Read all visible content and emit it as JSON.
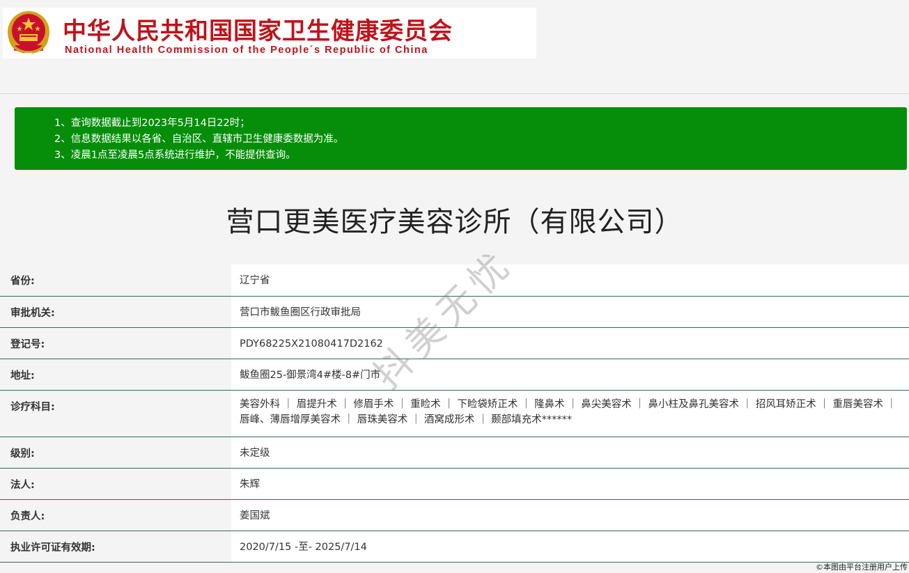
{
  "header": {
    "logo_cn": "中华人民共和国国家卫生健康委员会",
    "logo_en": "National Health Commission of the People´s Republic of China",
    "brand_red": "#c0121a"
  },
  "notice": {
    "bg_color": "#068e0a",
    "lines": [
      "1、查询数据截止到2023年5月14日22时；",
      "2、信息数据结果以各省、自治区、直辖市卫生健康委数据为准。",
      "3、凌晨1点至凌晨5点系统进行维护，不能提供查询。"
    ]
  },
  "org": {
    "title": "营口更美医疗美容诊所（有限公司）"
  },
  "fields": [
    {
      "label": "省份:",
      "value": "辽宁省"
    },
    {
      "label": "审批机关:",
      "value": "营口市鲅鱼圈区行政审批局"
    },
    {
      "label": "登记号:",
      "value": "PDY68225X21080417D2162"
    },
    {
      "label": "地址:",
      "value": "鲅鱼圈25-御景湾4#楼-8#门市"
    },
    {
      "label": "诊疗科目:",
      "value": "美容外科 ｜ 眉提升术 ｜ 修眉手术 ｜ 重睑术 ｜ 下睑袋矫正术 ｜ 隆鼻术 ｜ 鼻尖美容术 ｜ 鼻小柱及鼻孔美容术 ｜ 招风耳矫正术 ｜ 重唇美容术 ｜ 唇峰、薄唇增厚美容术 ｜ 唇珠美容术 ｜ 酒窝成形术 ｜ 颞部填充术******"
    },
    {
      "label": "级别:",
      "value": "未定级"
    },
    {
      "label": "法人:",
      "value": "朱辉"
    },
    {
      "label": "负责人:",
      "value": "姜国斌"
    },
    {
      "label": "执业许可证有效期:",
      "value": "2020/7/15 -至- 2025/7/14"
    }
  ],
  "watermark": "抖美无忧",
  "footer_note": "©本图由平台注册用户上传"
}
